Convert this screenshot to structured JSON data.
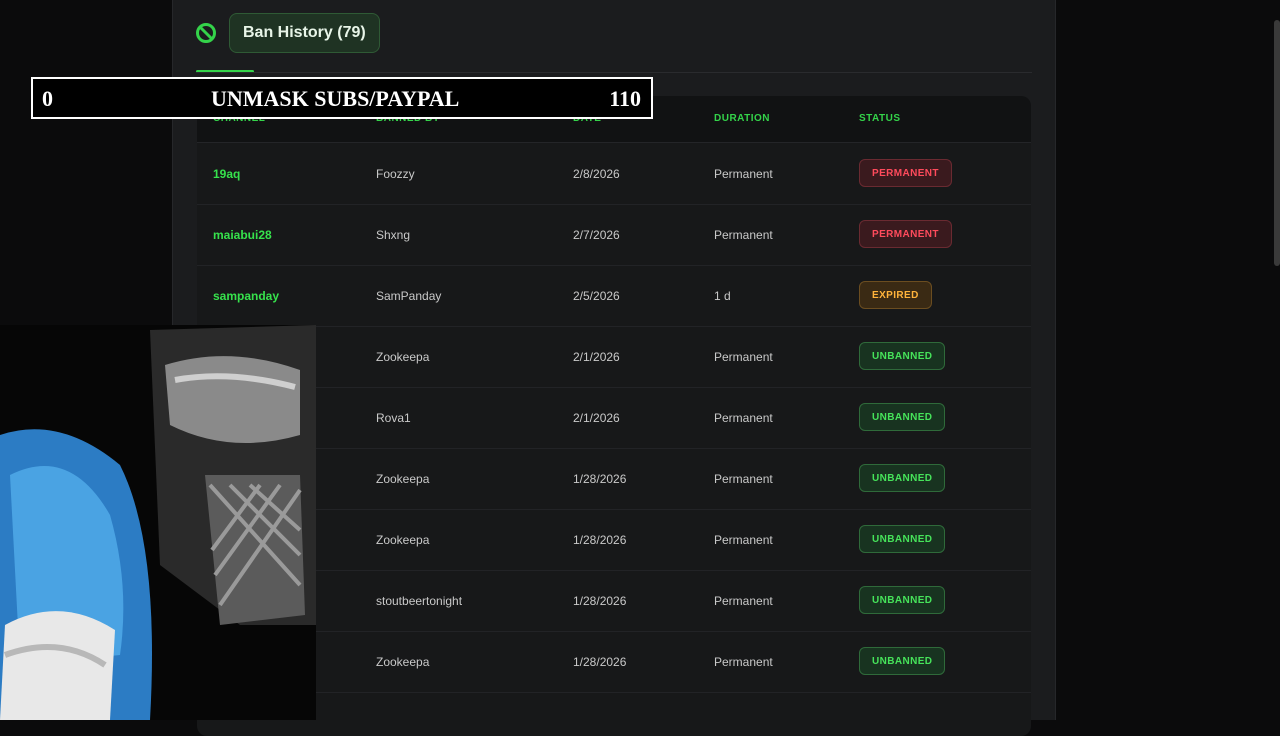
{
  "tab": {
    "label": "Ban History (79)"
  },
  "table": {
    "headers": [
      "CHANNEL",
      "BANNED BY",
      "DATE",
      "DURATION",
      "STATUS"
    ],
    "rows": [
      {
        "channel": "19aq",
        "banned_by": "Foozzy",
        "date": "2/8/2026",
        "duration": "Permanent",
        "status": "PERMANENT"
      },
      {
        "channel": "maiabui28",
        "banned_by": "Shxng",
        "date": "2/7/2026",
        "duration": "Permanent",
        "status": "PERMANENT"
      },
      {
        "channel": "sampanday",
        "banned_by": "SamPanday",
        "date": "2/5/2026",
        "duration": "1 d",
        "status": "EXPIRED"
      },
      {
        "channel": "",
        "banned_by": "Zookeepa",
        "date": "2/1/2026",
        "duration": "Permanent",
        "status": "UNBANNED"
      },
      {
        "channel": "",
        "banned_by": "Rova1",
        "date": "2/1/2026",
        "duration": "Permanent",
        "status": "UNBANNED"
      },
      {
        "channel": "",
        "banned_by": "Zookeepa",
        "date": "1/28/2026",
        "duration": "Permanent",
        "status": "UNBANNED"
      },
      {
        "channel": "",
        "banned_by": "Zookeepa",
        "date": "1/28/2026",
        "duration": "Permanent",
        "status": "UNBANNED"
      },
      {
        "channel": "",
        "banned_by": "stoutbeertonight",
        "date": "1/28/2026",
        "duration": "Permanent",
        "status": "UNBANNED"
      },
      {
        "channel": "",
        "banned_by": "Zookeepa",
        "date": "1/28/2026",
        "duration": "Permanent",
        "status": "UNBANNED"
      }
    ]
  },
  "overlay": {
    "left_value": "0",
    "label": "UNMASK SUBS/PAYPAL",
    "right_value": "110"
  },
  "colors": {
    "accent": "#34d34a",
    "permanent": "#ff4b5c",
    "expired": "#ffb33b",
    "unbanned": "#46e35a"
  },
  "icons": {
    "tab_icon": "ban-icon"
  }
}
